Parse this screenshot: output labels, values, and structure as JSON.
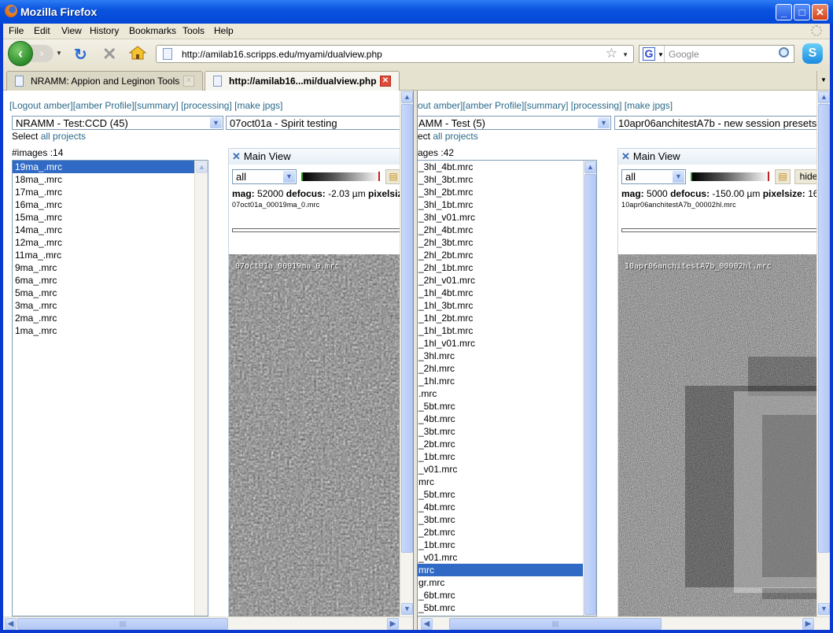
{
  "window": {
    "title": "Mozilla Firefox",
    "controls": {
      "minimize": "_",
      "maximize": "□",
      "close": "✕"
    }
  },
  "menu": [
    "File",
    "Edit",
    "View",
    "History",
    "Bookmarks",
    "Tools",
    "Help"
  ],
  "nav": {
    "url": "http://amilab16.scripps.edu/myami/dualview.php",
    "search_placeholder": "Google",
    "search_engine": "G"
  },
  "tabs": [
    {
      "label": "NRAMM: Appion and Leginon Tools",
      "active": false
    },
    {
      "label": "http://amilab16...mi/dualview.php",
      "active": true
    }
  ],
  "left_pane": {
    "links": "[Logout amber][amber Profile][summary] [processing] [make jpgs]",
    "project_select": "NRAMM - Test:CCD (45)",
    "session_select": "07oct01a - Spirit testing",
    "select_prefix": "Select",
    "select_link": "all projects",
    "image_count": "#images :14",
    "images": [
      "19ma_.mrc",
      "18ma_.mrc",
      "17ma_.mrc",
      "16ma_.mrc",
      "15ma_.mrc",
      "14ma_.mrc",
      "12ma_.mrc",
      "11ma_.mrc",
      "9ma_.mrc",
      "6ma_.mrc",
      "5ma_.mrc",
      "3ma_.mrc",
      "2ma_.mrc",
      "1ma_.mrc"
    ],
    "selected_index": 0,
    "main_view": {
      "title": "Main View",
      "filter": "all",
      "mag_label": "mag:",
      "mag": "52000",
      "defocus_label": "defocus:",
      "defocus": "-2.03 µm",
      "pixelsize_label": "pixelsiz",
      "filename": "07oct01a_00019ma_0.mrc",
      "overlay": "07oct01a_00019ma_0.mrc"
    }
  },
  "right_pane": {
    "links": "out amber][amber Profile][summary] [processing] [make jpgs]",
    "project_select": "AMM - Test (5)",
    "session_select": "10apr06anchitestA7b - new session presets",
    "select_prefix": "ect",
    "select_link": "all projects",
    "image_count": "ages :42",
    "images": [
      "_3hl_4bt.mrc",
      "_3hl_3bt.mrc",
      "_3hl_2bt.mrc",
      "_3hl_1bt.mrc",
      "_3hl_v01.mrc",
      "_2hl_4bt.mrc",
      "_2hl_3bt.mrc",
      "_2hl_2bt.mrc",
      "_2hl_1bt.mrc",
      "_2hl_v01.mrc",
      "_1hl_4bt.mrc",
      "_1hl_3bt.mrc",
      "_1hl_2bt.mrc",
      "_1hl_1bt.mrc",
      "_1hl_v01.mrc",
      "_3hl.mrc",
      "_2hl.mrc",
      "_1hl.mrc",
      ".mrc",
      "_5bt.mrc",
      "_4bt.mrc",
      "_3bt.mrc",
      "_2bt.mrc",
      "_1bt.mrc",
      "_v01.mrc",
      "mrc",
      "_5bt.mrc",
      "_4bt.mrc",
      "_3bt.mrc",
      "_2bt.mrc",
      "_1bt.mrc",
      "_v01.mrc",
      "mrc",
      "gr.mrc",
      "_6bt.mrc",
      "_5bt.mrc"
    ],
    "selected_index": 32,
    "main_view": {
      "title": "Main View",
      "filter": "all",
      "hide_label": "hide",
      "mag_label": "mag:",
      "mag": "5000",
      "defocus_label": "defocus:",
      "defocus": "-150.00 µm",
      "pixelsize_label": "pixelsize:",
      "pixelsize": "16",
      "filename": "10apr06anchitestA7b_00002hl.mrc",
      "overlay": "10apr06anchitestA7b_00002hl.mrc"
    }
  }
}
